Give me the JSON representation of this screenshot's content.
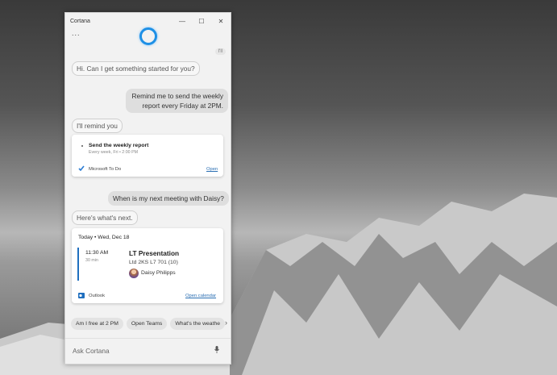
{
  "window": {
    "title": "Cortana",
    "more_label": "...",
    "minimize": "—",
    "maximize": "☐",
    "close": "✕"
  },
  "conversation": {
    "small_badge": "l'll",
    "greeting": "Hi. Can I get something started for you?",
    "user_request_1": "Remind me to send the weekly report every Friday at 2PM.",
    "reply_1": "I'll remind you",
    "user_request_2": "When is my next meeting with Daisy?",
    "reply_2": "Here's what's next."
  },
  "reminder_card": {
    "task_title": "Send the weekly report",
    "task_sub": "Every week, Fri • 2:00 PM",
    "app_name": "Microsoft To Do",
    "open_link": "Open"
  },
  "meeting_card": {
    "date_header": "Today • Wed, Dec 18",
    "time": "11:30 AM",
    "duration": "30 min",
    "event_title": "LT Presentation",
    "location": "Ltd 2KS L7 701 (10)",
    "attendee": "Daisy Philipps",
    "app_name": "Outlook",
    "open_link": "Open calendar"
  },
  "suggestions": [
    "Am I free at 2 PM",
    "Open Teams",
    "What's the weathe"
  ],
  "suggestion_more": "›",
  "input": {
    "placeholder": "Ask Cortana"
  },
  "colors": {
    "accent": "#1e90e6",
    "link": "#2b6fb3"
  },
  "icons": [
    "cortana-ring-icon",
    "check-icon",
    "outlook-icon",
    "microphone-icon",
    "chevron-right-icon"
  ]
}
